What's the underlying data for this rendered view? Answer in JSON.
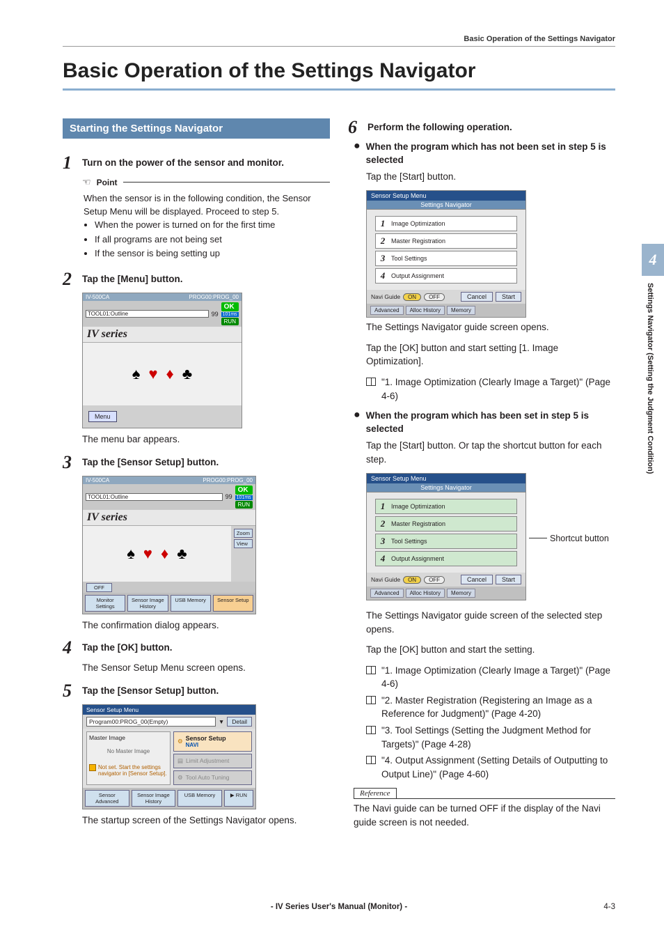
{
  "running_head": "Basic Operation of the Settings Navigator",
  "page_title": "Basic Operation of the Settings Navigator",
  "section_bar": "Starting the Settings Navigator",
  "side": {
    "chapter": "4",
    "label": "Settings Navigator (Setting the Judgment Condition)"
  },
  "footer": {
    "center": "- IV Series User's Manual (Monitor) -",
    "page": "4-3"
  },
  "steps": {
    "s1": {
      "num": "1",
      "text": "Turn on the power of the sensor and monitor."
    },
    "s2": {
      "num": "2",
      "text": "Tap the [Menu] button.",
      "caption": "The menu bar appears."
    },
    "s3": {
      "num": "3",
      "text": "Tap the [Sensor Setup] button.",
      "caption": "The confirmation dialog appears."
    },
    "s4": {
      "num": "4",
      "text": "Tap the [OK] button.",
      "caption": "The Sensor Setup Menu screen opens."
    },
    "s5": {
      "num": "5",
      "text": "Tap the [Sensor Setup] button.",
      "caption": "The startup screen of the Settings Navigator opens."
    },
    "s6": {
      "num": "6",
      "text": "Perform the following operation."
    }
  },
  "point": {
    "label": "Point",
    "intro": "When the sensor is in the following condition, the Sensor Setup Menu will be displayed. Proceed to step 5.",
    "b1": "When the power is turned on for the first time",
    "b2": "If all programs are not being set",
    "b3": "If the sensor is being setting up"
  },
  "iv": {
    "model": "IV-500CA",
    "prog": "PROG00:PROG_00",
    "tool": "TOOL01:Outline",
    "series": "IV series",
    "ok": "OK",
    "ms": "101ms",
    "run": "RUN",
    "score": "99",
    "menu": "Menu",
    "zoom": "Zoom",
    "view": "View",
    "off": "OFF",
    "tab_monitor": "Monitor Settings",
    "tab_sensor_hist": "Sensor Image History",
    "tab_usb": "USB Memory",
    "tab_sensor_setup": "Sensor Setup"
  },
  "smenu": {
    "title": "Sensor Setup Menu",
    "subtitle": "Settings Navigator",
    "i1": "Image Optimization",
    "i2": "Master Registration",
    "i3": "Tool Settings",
    "i4": "Output Assignment",
    "navi": "Navi Guide",
    "on": "ON",
    "off": "OFF",
    "cancel": "Cancel",
    "start": "Start",
    "tab_adv": "Advanced",
    "tab_hist": "Alloc History",
    "tab_mem": "Memory"
  },
  "prog": {
    "title": "Sensor Setup Menu",
    "drop": "Program00:PROG_00(Empty)",
    "detail": "Detail",
    "master": "Master Image",
    "no_master": "No Master Image",
    "warn": "Not set. Start the settings navigator in [Sensor Setup].",
    "btn_setup": "Sensor Setup",
    "navi": "NAVI",
    "btn_limit": "Limit Adjustment",
    "btn_auto": "Tool Auto Tuning",
    "tab_adv": "Sensor Advanced",
    "tab_hist": "Sensor Image History",
    "tab_usb": "USB Memory",
    "run": "RUN"
  },
  "r": {
    "case_a_head": "When the program which has not been set in step 5 is selected",
    "case_a_tap": "Tap the [Start] button.",
    "case_a_after1": "The Settings Navigator guide screen opens.",
    "case_a_after2": "Tap the [OK] button and start setting [1. Image Optimization].",
    "case_a_ref": "\"1. Image Optimization (Clearly Image a Target)\" (Page 4-6)",
    "case_b_head": "When the program which has been set in step 5 is selected",
    "case_b_tap": "Tap the [Start] button. Or tap the shortcut button for each step.",
    "shortcut": "Shortcut button",
    "case_b_after1": "The Settings Navigator guide screen of the selected step opens.",
    "case_b_after2": "Tap the [OK] button and start the setting.",
    "ref1": "\"1. Image Optimization (Clearly Image a Target)\" (Page 4-6)",
    "ref2": "\"2. Master Registration (Registering an Image as a Reference for Judgment)\" (Page 4-20)",
    "ref3": "\"3. Tool Settings (Setting the Judgment Method for Targets)\" (Page 4-28)",
    "ref4": "\"4. Output Assignment (Setting Details of Outputting to Output Line)\" (Page 4-60)",
    "reference_label": "Reference",
    "reference_text": "The Navi guide can be turned OFF if the display of the Navi guide screen is not needed."
  }
}
